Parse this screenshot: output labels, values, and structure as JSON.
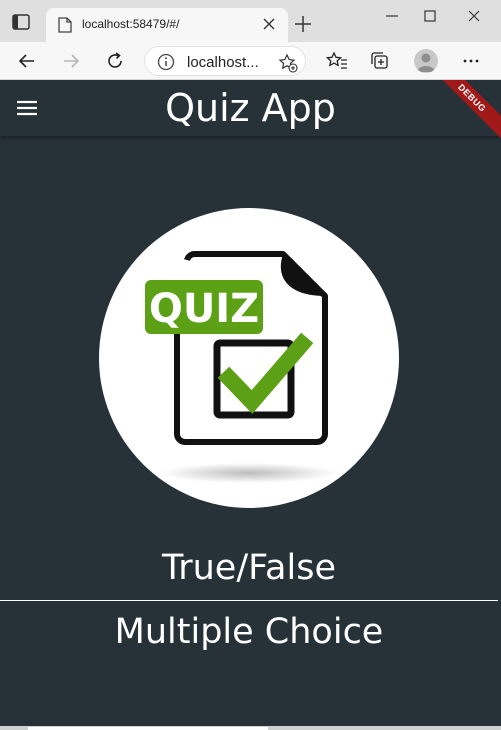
{
  "browser": {
    "tab_title": "localhost:58479/#/",
    "address_url": "localhost...",
    "icons": {
      "tab_actions": "tab-actions-icon",
      "favicon": "page-icon",
      "tab_close": "close-icon",
      "new_tab": "plus-icon",
      "back": "arrow-left-icon",
      "forward": "arrow-right-icon",
      "refresh": "refresh-icon",
      "info": "info-icon",
      "add_favorite": "star-plus-icon",
      "favorites": "favorites-icon",
      "collections": "collections-icon",
      "profile": "avatar-icon",
      "more": "more-icon"
    }
  },
  "app": {
    "title": "Quiz App",
    "debug_banner": "DEBUG",
    "logo": {
      "badge_text": "QUIZ",
      "badge_color": "#5ba015",
      "check_color": "#5ba015"
    },
    "options": [
      {
        "label": "True/False"
      },
      {
        "label": "Multiple Choice"
      }
    ],
    "colors": {
      "background": "#263238",
      "text": "#ffffff"
    }
  }
}
